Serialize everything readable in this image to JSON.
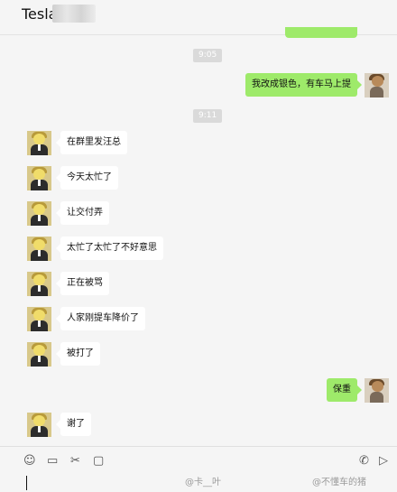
{
  "header": {
    "title": "Tesla",
    "menu_glyph": "···"
  },
  "messages": {
    "time1": "9:05",
    "time2": "9:11",
    "out1": "我改成银色，有车马上提",
    "in1": "在群里发汪总",
    "in2": "今天太忙了",
    "in3": "让交付弄",
    "in4": "太忙了太忙了不好意思",
    "in5": "正在被骂",
    "in6": "人家刚提车降价了",
    "in7": "被打了",
    "out2": "保重",
    "in8": "谢了"
  },
  "toolbar": {
    "emoji_icon": "☺",
    "folder_icon": "▭",
    "scissors_icon": "✂",
    "chat_icon": "▢",
    "phone_icon": "✆",
    "video_icon": "▷"
  },
  "watermark": {
    "left": "@卡__叶",
    "right": "@不懂车的猪"
  },
  "colors": {
    "outgoing_bubble": "#9eea6a",
    "incoming_bubble": "#ffffff",
    "background": "#f5f5f5",
    "time_badge": "#dadada"
  }
}
